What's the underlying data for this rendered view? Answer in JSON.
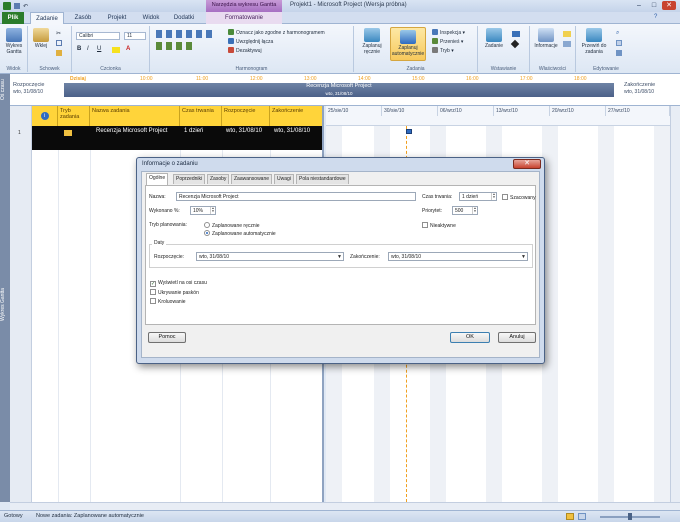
{
  "titlebar": {
    "title": "Projekt1 - Microsoft Project (Wersja próbna)",
    "context_tab_group": "Narzędzia wykresu Gantta",
    "min": "–",
    "max": "□",
    "close": "✕"
  },
  "tabs": [
    "Plik",
    "Zadanie",
    "Zasób",
    "Projekt",
    "Widok",
    "Dodatki",
    "Formatowanie"
  ],
  "ribbon": {
    "groups": [
      "Widok",
      "Schowek",
      "Czcionka",
      "Harmonogram",
      "Zadania",
      "Wstawianie",
      "Właściwości",
      "Edytowanie"
    ],
    "gantt_btn": "Wykres Gantta",
    "paste_btn": "Wklej",
    "font_name": "Calibri",
    "font_size": "11",
    "bold": "B",
    "italic": "I",
    "underline": "U",
    "mark_on_track": "Oznacz jako zgodne z harmonogramem",
    "respect_links": "Uwzględnij łącza",
    "inactivate": "Dezaktywuj",
    "manual_schedule": "Zaplanuj ręcznie",
    "auto_schedule": "Zaplanuj automatycznie",
    "inspect": "Inspekcja",
    "move": "Przenieś",
    "mode": "Tryb",
    "task_btn": "Zadanie",
    "information_btn": "Informacje",
    "scroll_to_task": "Przewiń do zadania"
  },
  "timeline": {
    "start_label": "Rozpoczęcie",
    "start_date": "wto, 31/08/10",
    "end_label": "Zakończenie",
    "end_date": "wto, 31/08/10",
    "today": "Dzisiaj",
    "ticks": [
      "10:00",
      "11:00",
      "12:00",
      "13:00",
      "14:00",
      "15:00",
      "16:00",
      "17:00",
      "18:00"
    ],
    "bar_title": "Recenzja Microsoft Project",
    "bar_date": "wto, 31/08/10",
    "side_label": "Oś czasu"
  },
  "grid": {
    "side_label": "Wykres Gantta",
    "info_icon": "i",
    "headers": {
      "mode": "Tryb zadania",
      "name": "Nazwa zadania",
      "duration": "Czas trwania",
      "start": "Rozpoczęcie",
      "finish": "Zakończenie"
    },
    "rows": [
      {
        "id": "1",
        "name": "Recenzja Microsoft Project",
        "duration": "1 dzień",
        "start": "wto, 31/08/10",
        "finish": "wto, 31/08/10"
      }
    ]
  },
  "gantt": {
    "weeks": [
      "25/sie/10",
      "30/sie/10",
      "06/wrz/10",
      "13/wrz/10",
      "20/wrz/10",
      "27/wrz/10"
    ]
  },
  "statusbar": {
    "ready": "Gotowy",
    "new_tasks": "Nowe zadania: Zaplanowane automatycznie"
  },
  "dialog": {
    "title": "Informacje o zadaniu",
    "close": "✕",
    "tabs": [
      "Ogólne",
      "Poprzedniki",
      "Zasoby",
      "Zaawansowane",
      "Uwagi",
      "Pola niestandardowe"
    ],
    "name_label": "Nazwa:",
    "name_value": "Recenzja Microsoft Project",
    "duration_label": "Czas trwania:",
    "duration_value": "1 dzień",
    "estimated_label": "Szacowany",
    "percent_label": "Wykonano %:",
    "percent_value": "10%",
    "priority_label": "Priorytet:",
    "priority_value": "500",
    "schedule_mode_label": "Tryb planowania:",
    "manual_label": "Zaplanowane ręcznie",
    "auto_label": "Zaplanowane automatycznie",
    "inactive_label": "Nieaktywne",
    "dates_legend": "Daty",
    "start_label": "Rozpoczęcie:",
    "start_value": "wto, 31/08/10",
    "finish_label": "Zakończenie:",
    "finish_value": "wto, 31/08/10",
    "show_on_timeline": "Wyświetl na osi czasu",
    "hide_bar": "Ukrywanie paskón",
    "rollup": "Kroluowanie",
    "help_btn": "Pomoc",
    "ok_btn": "OK",
    "cancel_btn": "Anuluj"
  },
  "colors": {
    "accent": "#ffd43a",
    "file_tab": "#2b7c2b",
    "context_tab": "#a66fc2",
    "highlight": "#f7c95c"
  }
}
